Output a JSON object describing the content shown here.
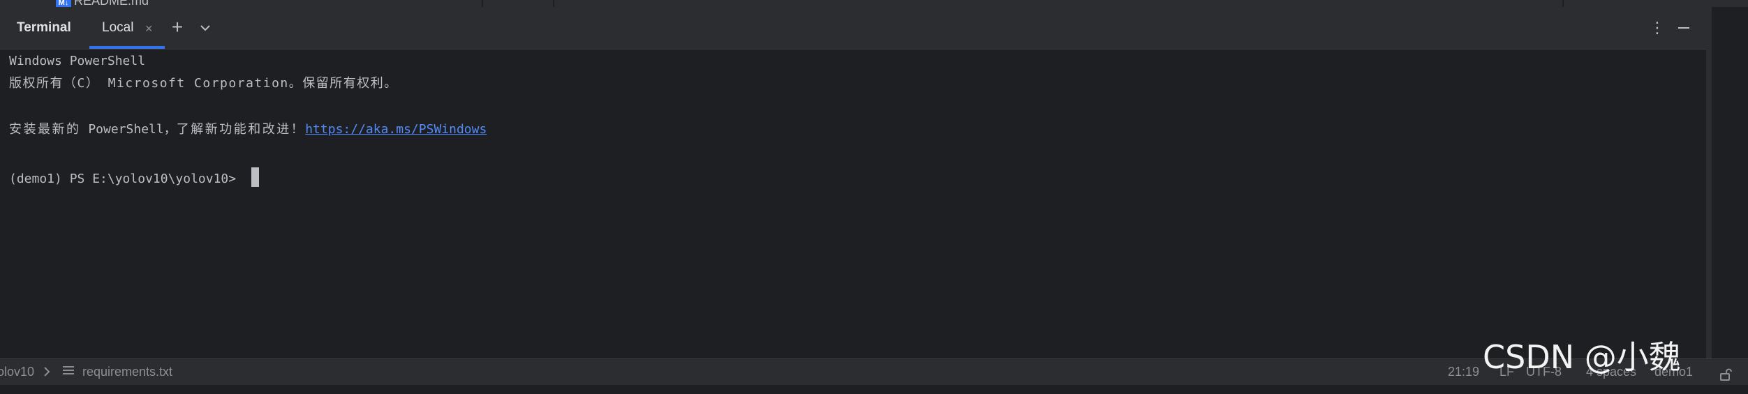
{
  "project_tree": {
    "partial_item": "README.md",
    "icon_label": "M↓"
  },
  "tool_window": {
    "title": "Terminal",
    "tabs": [
      {
        "label": "Local",
        "close_glyph": "×"
      }
    ],
    "new_tab_glyph": "+",
    "more_glyph": "⋮"
  },
  "terminal": {
    "lines": {
      "shell_name": "Windows PowerShell",
      "copyright": "版权所有（C） Microsoft Corporation。保留所有权利。",
      "install_prefix": "安装最新的",
      "install_mid": " PowerShell，",
      "install_suffix": "了解新功能和改进！",
      "install_link": "https://aka.ms/PSWindows",
      "prompt": "(demo1) PS E:\\yolov10\\yolov10> "
    }
  },
  "status_bar": {
    "breadcrumb": [
      "olov10",
      "requirements.txt"
    ],
    "caret_position": "21:19",
    "line_separator": "LF",
    "encoding": "UTF-8",
    "indent": "4 spaces",
    "interpreter": "demo1"
  },
  "watermark": {
    "text": "CSDN @小魏"
  },
  "colors": {
    "background": "#1e1f22",
    "panel": "#2b2d30",
    "text": "#bcbec4",
    "accent": "#3574f0",
    "link": "#548af7"
  },
  "icons": [
    "markdown-icon",
    "close-icon",
    "plus-icon",
    "chevron-down-icon",
    "more-vertical-icon",
    "minimize-icon",
    "chevron-right-icon",
    "file-text-icon",
    "lock-icon"
  ]
}
